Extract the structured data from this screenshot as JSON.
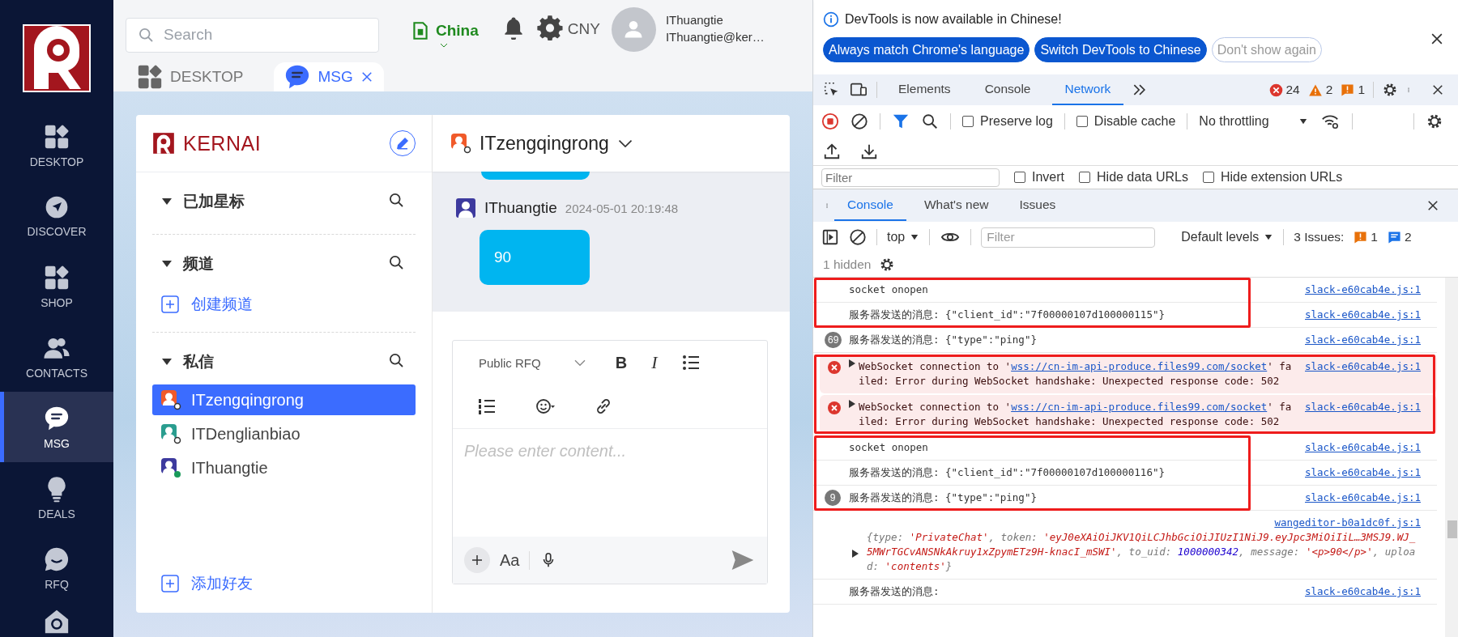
{
  "nav": {
    "items": [
      {
        "label": "DESKTOP",
        "selected": false
      },
      {
        "label": "DISCOVER",
        "selected": false
      },
      {
        "label": "SHOP",
        "selected": false
      },
      {
        "label": "CONTACTS",
        "selected": false
      },
      {
        "label": "MSG",
        "selected": true
      },
      {
        "label": "DEALS",
        "selected": false
      },
      {
        "label": "RFQ",
        "selected": false
      }
    ]
  },
  "topbar": {
    "search": {
      "placeholder": "Search"
    },
    "region": "China",
    "currency": "CNY",
    "user": {
      "name": "IThuangtie",
      "email": "IThuangtie@ker…"
    }
  },
  "tabs": [
    {
      "label": "DESKTOP",
      "selected": false,
      "closable": false
    },
    {
      "label": "MSG",
      "selected": true,
      "closable": true
    }
  ],
  "chat": {
    "brand": "KERNAI",
    "sections": [
      {
        "title": "已加星标",
        "expanded": true
      },
      {
        "title": "频道",
        "expanded": true,
        "action": "创建频道"
      },
      {
        "title": "私信",
        "expanded": true,
        "contacts": [
          {
            "name": "ITzengqingrong",
            "color": "#f05a2a",
            "online": false,
            "selected": true
          },
          {
            "name": "ITDenglianbiao",
            "color": "#2a9d8f",
            "online": false,
            "selected": false
          },
          {
            "name": "IThuangtie",
            "color": "#3d3a9e",
            "online": true,
            "selected": false
          }
        ]
      }
    ],
    "add_friend": "添加好友"
  },
  "conversation": {
    "title": "ITzengqingrong",
    "color": "#f05a2a",
    "online": false,
    "messages": [
      {
        "author": "IThuangtie",
        "color": "#3d3a9e",
        "time": "2024-05-01 20:19:48",
        "text": "90"
      }
    ],
    "editor": {
      "format": "Public RFQ",
      "tools": [
        {
          "kind": "bold",
          "label": "B"
        },
        {
          "kind": "italic",
          "label": "I"
        },
        {
          "kind": "bullets"
        },
        {
          "kind": "numbered"
        },
        {
          "kind": "emoji"
        },
        {
          "kind": "link"
        }
      ],
      "placeholder": "Please enter content...",
      "font_button": "Aa"
    }
  },
  "devtools": {
    "banner": {
      "message": "DevTools is now available in Chinese!",
      "buttons": [
        {
          "label": "Always match Chrome's language",
          "kind": "primary"
        },
        {
          "label": "Switch DevTools to Chinese",
          "kind": "primary"
        },
        {
          "label": "Don't show again",
          "kind": "outline"
        }
      ]
    },
    "tabs": [
      {
        "label": "Elements",
        "selected": false
      },
      {
        "label": "Console",
        "selected": false
      },
      {
        "label": "Network",
        "selected": true
      }
    ],
    "errors": "24",
    "warnings": "2",
    "issues": "1",
    "network_toolbar": {
      "checkboxes": [
        {
          "label": "Preserve log",
          "checked": false
        },
        {
          "label": "Disable cache",
          "checked": false
        }
      ],
      "throttling": "No throttling"
    },
    "filter_row": {
      "placeholder": "Filter",
      "checkboxes": [
        {
          "label": "Invert",
          "checked": false
        },
        {
          "label": "Hide data URLs",
          "checked": false
        },
        {
          "label": "Hide extension URLs",
          "checked": false
        }
      ]
    },
    "drawer_tabs": [
      {
        "label": "Console",
        "selected": true
      },
      {
        "label": "What's new",
        "selected": false
      },
      {
        "label": "Issues",
        "selected": false
      }
    ],
    "console_toolbar": {
      "context": "top",
      "placeholder": "Filter",
      "levels": "Default levels",
      "issues_label": "3 Issues:",
      "issue_counts": [
        "1",
        "2"
      ]
    },
    "hidden": "1 hidden",
    "groups": [
      {
        "highlighted": true,
        "entries": [
          {
            "kind": "log",
            "text": "socket onopen",
            "source": "slack-e60cab4e.js:1"
          },
          {
            "kind": "log",
            "text": "服务器发送的消息: {\"client_id\":\"7f00000107d100000115\"}",
            "source": "slack-e60cab4e.js:1"
          }
        ]
      },
      {
        "highlighted": false,
        "entries": [
          {
            "kind": "log",
            "count": "69",
            "text": "服务器发送的消息: {\"type\":\"ping\"}",
            "source": "slack-e60cab4e.js:1"
          }
        ]
      },
      {
        "highlighted": true,
        "entries": [
          {
            "kind": "error",
            "text": "WebSocket connection to '",
            "link": "wss://cn-im-api-produce.files99.com/socket",
            "after": "' failed: Error during WebSocket handshake: Unexpected response code: 502",
            "source": "slack-e60cab4e.js:1"
          },
          {
            "kind": "error",
            "text": "WebSocket connection to '",
            "link": "wss://cn-im-api-produce.files99.com/socket",
            "after": "' failed: Error during WebSocket handshake: Unexpected response code: 502",
            "source": "slack-e60cab4e.js:1"
          }
        ]
      },
      {
        "highlighted": true,
        "entries": [
          {
            "kind": "log",
            "text": "socket onopen",
            "source": "slack-e60cab4e.js:1"
          },
          {
            "kind": "log",
            "text": "服务器发送的消息: {\"client_id\":\"7f00000107d100000116\"}",
            "source": "slack-e60cab4e.js:1"
          },
          {
            "kind": "log",
            "count": "9",
            "text": "服务器发送的消息: {\"type\":\"ping\"}",
            "source": "slack-e60cab4e.js:1"
          }
        ]
      },
      {
        "highlighted": false,
        "entries": [
          {
            "kind": "object",
            "source": "wangeditor-b0a1dc0f.js:1",
            "parts": [
              {
                "text": "{type: ",
                "kind": "key"
              },
              {
                "text": "'PrivateChat'",
                "kind": "string"
              },
              {
                "text": ", token: ",
                "kind": "key"
              },
              {
                "text": "'eyJ0eXAiOiJKV1QiLCJhbGciOiJIUzI1NiJ9.eyJpc3MiOiIiL…3MSJ9.WJ_5MWrTGCvANSNkAkruy1xZpymETz9H-knacI_mSWI'",
                "kind": "string"
              },
              {
                "text": ", to_uid: ",
                "kind": "key"
              },
              {
                "text": "1000000342",
                "kind": "number"
              },
              {
                "text": ", message: ",
                "kind": "key"
              },
              {
                "text": "'<p>90</p>'",
                "kind": "string"
              },
              {
                "text": ", upload: ",
                "kind": "key"
              },
              {
                "text": "'contents'",
                "kind": "string"
              },
              {
                "text": "}",
                "kind": "key"
              }
            ]
          },
          {
            "kind": "log",
            "text": "服务器发送的消息:",
            "source": "slack-e60cab4e.js:1"
          }
        ]
      }
    ]
  }
}
